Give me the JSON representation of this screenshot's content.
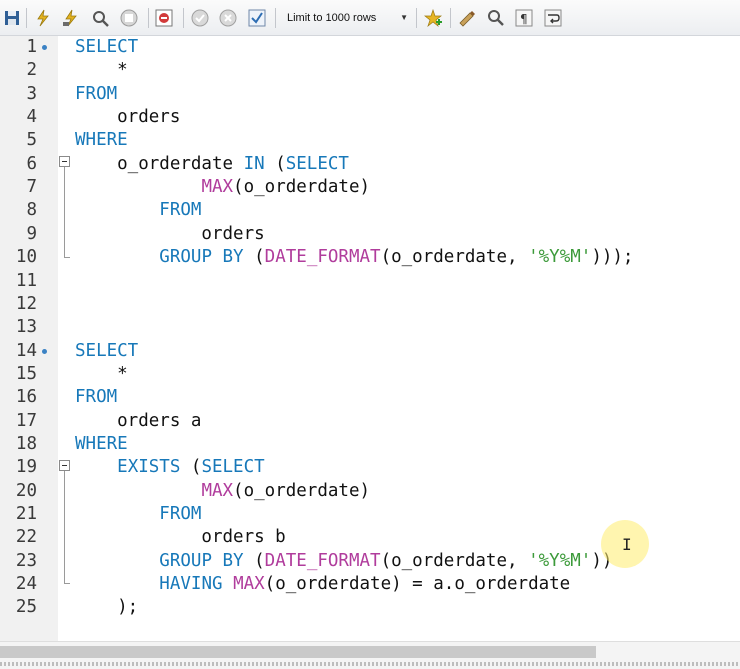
{
  "toolbar": {
    "buttons": [
      {
        "name": "save-icon"
      },
      {
        "name": "execute-icon"
      },
      {
        "name": "execute-current-icon"
      },
      {
        "name": "explain-icon"
      },
      {
        "name": "stop-icon"
      },
      {
        "name": "toggle-continue-on-error-icon"
      },
      {
        "name": "commit-icon"
      },
      {
        "name": "rollback-icon"
      },
      {
        "name": "autocommit-icon"
      }
    ],
    "limit_select": "Limit to 1000 rows",
    "right_buttons": [
      {
        "name": "add-snippet-icon"
      },
      {
        "name": "beautify-icon"
      },
      {
        "name": "find-icon"
      },
      {
        "name": "invisible-chars-icon"
      },
      {
        "name": "wrap-lines-icon"
      }
    ]
  },
  "editor": {
    "lines": [
      {
        "n": "1",
        "tokens": [
          [
            "kw",
            "SELECT"
          ]
        ]
      },
      {
        "n": "2",
        "tokens": [
          [
            "",
            "    *"
          ]
        ]
      },
      {
        "n": "3",
        "tokens": [
          [
            "kw",
            "FROM"
          ]
        ]
      },
      {
        "n": "4",
        "tokens": [
          [
            "",
            "    orders"
          ]
        ]
      },
      {
        "n": "5",
        "tokens": [
          [
            "kw",
            "WHERE"
          ]
        ]
      },
      {
        "n": "6",
        "tokens": [
          [
            "",
            "    o_orderdate "
          ],
          [
            "kw",
            "IN"
          ],
          [
            "",
            " ("
          ],
          [
            "kw",
            "SELECT"
          ]
        ]
      },
      {
        "n": "7",
        "tokens": [
          [
            "",
            "            "
          ],
          [
            "fn",
            "MAX"
          ],
          [
            "",
            "(o_orderdate)"
          ]
        ]
      },
      {
        "n": "8",
        "tokens": [
          [
            "",
            "        "
          ],
          [
            "kw",
            "FROM"
          ]
        ]
      },
      {
        "n": "9",
        "tokens": [
          [
            "",
            "            orders"
          ]
        ]
      },
      {
        "n": "10",
        "tokens": [
          [
            "",
            "        "
          ],
          [
            "kw",
            "GROUP BY"
          ],
          [
            "",
            " ("
          ],
          [
            "fn",
            "DATE_FORMAT"
          ],
          [
            "",
            "(o_orderdate, "
          ],
          [
            "str",
            "'%Y%M'"
          ],
          [
            "",
            ")));"
          ]
        ]
      },
      {
        "n": "11",
        "tokens": []
      },
      {
        "n": "12",
        "tokens": []
      },
      {
        "n": "13",
        "tokens": []
      },
      {
        "n": "14",
        "tokens": [
          [
            "kw",
            "SELECT"
          ]
        ]
      },
      {
        "n": "15",
        "tokens": [
          [
            "",
            "    *"
          ]
        ]
      },
      {
        "n": "16",
        "tokens": [
          [
            "kw",
            "FROM"
          ]
        ]
      },
      {
        "n": "17",
        "tokens": [
          [
            "",
            "    orders a"
          ]
        ]
      },
      {
        "n": "18",
        "tokens": [
          [
            "kw",
            "WHERE"
          ]
        ]
      },
      {
        "n": "19",
        "tokens": [
          [
            "",
            "    "
          ],
          [
            "kw",
            "EXISTS"
          ],
          [
            "",
            " ("
          ],
          [
            "kw",
            "SELECT"
          ]
        ]
      },
      {
        "n": "20",
        "tokens": [
          [
            "",
            "            "
          ],
          [
            "fn",
            "MAX"
          ],
          [
            "",
            "(o_orderdate)"
          ]
        ]
      },
      {
        "n": "21",
        "tokens": [
          [
            "",
            "        "
          ],
          [
            "kw",
            "FROM"
          ]
        ]
      },
      {
        "n": "22",
        "tokens": [
          [
            "",
            "            orders b"
          ]
        ]
      },
      {
        "n": "23",
        "tokens": [
          [
            "",
            "        "
          ],
          [
            "kw",
            "GROUP BY"
          ],
          [
            "",
            " ("
          ],
          [
            "fn",
            "DATE_FORMAT"
          ],
          [
            "",
            "(o_orderdate, "
          ],
          [
            "str",
            "'%Y%M'"
          ],
          [
            "",
            "))"
          ]
        ]
      },
      {
        "n": "24",
        "tokens": [
          [
            "",
            "        "
          ],
          [
            "kw",
            "HAVING"
          ],
          [
            " ",
            " "
          ],
          [
            "fn",
            "MAX"
          ],
          [
            "",
            "(o_orderdate) = a.o_orderdate"
          ]
        ]
      },
      {
        "n": "25",
        "tokens": [
          [
            "",
            "    );"
          ]
        ]
      }
    ],
    "bookmarks": [
      "1",
      "14"
    ],
    "fold_markers": [
      "6",
      "19"
    ]
  },
  "colors": {
    "keyword": "#1778b9",
    "function": "#b03c9c",
    "string": "#3c9a3a",
    "gutter": "#f1f1f1"
  }
}
